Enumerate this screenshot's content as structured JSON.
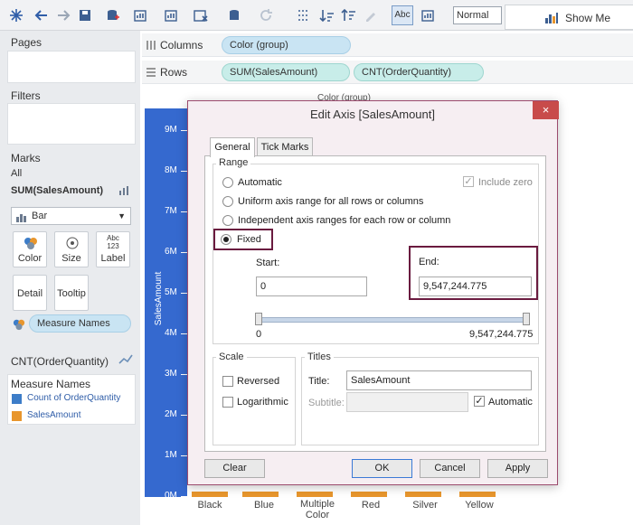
{
  "toolbar": {
    "view_mode": "Normal",
    "abc_label": "Abc",
    "show_me": "Show Me"
  },
  "left": {
    "pages_title": "Pages",
    "filters_title": "Filters",
    "marks_title": "Marks",
    "all_label": "All",
    "measure_label": "SUM(SalesAmount)",
    "mark_type": "Bar",
    "buttons": [
      {
        "label": "Color"
      },
      {
        "label": "Size"
      },
      {
        "label": "Label",
        "sub": "Abc\n123"
      },
      {
        "label": "Detail"
      },
      {
        "label": "Tooltip"
      }
    ],
    "measure_names_pill": "Measure Names",
    "cnt_label": "CNT(OrderQuantity)",
    "legend_title": "Measure Names",
    "legend_items": [
      {
        "label": "Count of OrderQuantity",
        "color": "#3d7dc8"
      },
      {
        "label": "SalesAmount",
        "color": "#e8962d"
      }
    ]
  },
  "shelves": {
    "columns_label": "Columns",
    "columns_pill": "Color (group)",
    "rows_label": "Rows",
    "rows_pills": [
      "SUM(SalesAmount)",
      "CNT(OrderQuantity)"
    ]
  },
  "view": {
    "column_header": "Color (group)",
    "axis_title": "SalesAmount",
    "ticks": [
      "9M",
      "8M",
      "7M",
      "6M",
      "5M",
      "4M",
      "3M",
      "2M",
      "1M",
      "0M"
    ],
    "categories": [
      "Black",
      "Blue",
      "Multiple Color",
      "Red",
      "Silver",
      "Yellow"
    ],
    "bar_color": "#e8962d",
    "axis_color": "#3569cf"
  },
  "dialog": {
    "title": "Edit Axis [SalesAmount]",
    "close": "×",
    "tabs": [
      "General",
      "Tick Marks"
    ],
    "range_label": "Range",
    "range_options": [
      "Automatic",
      "Uniform axis range for all rows or columns",
      "Independent axis ranges for each row or column",
      "Fixed"
    ],
    "include_zero": "Include zero",
    "start_label": "Start:",
    "end_label": "End:",
    "start_value": "0",
    "end_value": "9,547,244.775",
    "slider_min": "0",
    "slider_max": "9,547,244.775",
    "scale_label": "Scale",
    "reversed": "Reversed",
    "logarithmic": "Logarithmic",
    "titles_label": "Titles",
    "title_field_label": "Title:",
    "title_value": "SalesAmount",
    "subtitle_label": "Subtitle:",
    "automatic": "Automatic",
    "buttons": {
      "clear": "Clear",
      "ok": "OK",
      "cancel": "Cancel",
      "apply": "Apply"
    }
  }
}
